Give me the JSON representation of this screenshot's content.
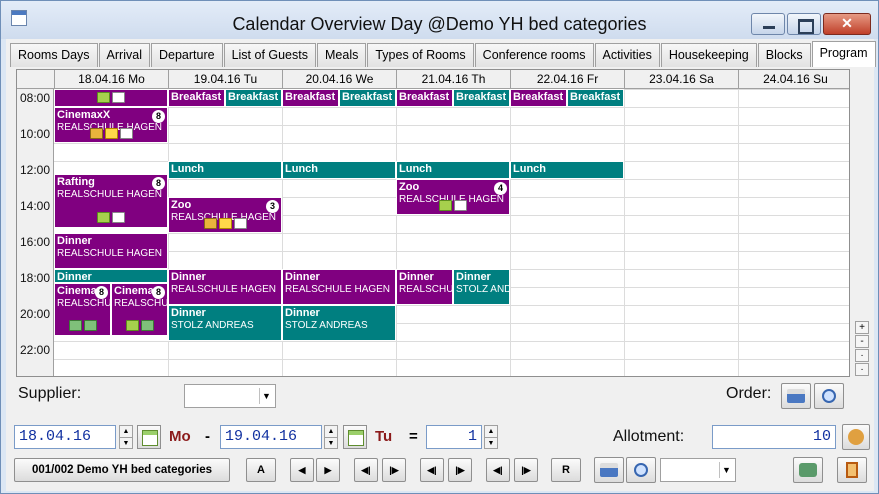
{
  "window": {
    "title": "Calendar Overview Day @Demo YH bed categories"
  },
  "tabs": [
    "Rooms Days",
    "Arrival",
    "Departure",
    "List of Guests",
    "Meals",
    "Types of Rooms",
    "Conference rooms",
    "Activities",
    "Housekeeping",
    "Blocks",
    "Program"
  ],
  "active_tab": "Program",
  "calendar": {
    "days": [
      "18.04.16 Mo",
      "19.04.16 Tu",
      "20.04.16 We",
      "21.04.16 Th",
      "22.04.16 Fr",
      "23.04.16 Sa",
      "24.04.16 Su"
    ],
    "times": [
      "08:00",
      "10:00",
      "12:00",
      "14:00",
      "16:00",
      "18:00",
      "20:00",
      "22:00"
    ],
    "events": [
      {
        "day": 0,
        "start": 8.0,
        "end": 9.0,
        "title": "",
        "sub": "",
        "color": "#800080",
        "icons": [
          "plus",
          "doc"
        ]
      },
      {
        "day": 0,
        "start": 9.0,
        "end": 11.0,
        "title": "CinemaxX",
        "sub": "REALSCHULE HAGEN",
        "count": "8",
        "color": "#800080",
        "icons": [
          "lock",
          "mail",
          "doc"
        ]
      },
      {
        "day": 0,
        "start": 12.7,
        "end": 15.7,
        "title": "Rafting",
        "sub": "REALSCHULE HAGEN",
        "count": "8",
        "color": "#800080",
        "icons": [
          "plus",
          "doc"
        ]
      },
      {
        "day": 0,
        "start": 16.0,
        "end": 18.0,
        "title": "Dinner",
        "sub": "REALSCHULE HAGEN",
        "color": "#800080"
      },
      {
        "day": 0,
        "start": 18.0,
        "end": 18.8,
        "title": "Dinner",
        "sub": "",
        "color": "#007f80"
      },
      {
        "day": 0,
        "start": 18.8,
        "end": 21.7,
        "title": "Cinema",
        "sub": "REALSCHULE",
        "count": "8",
        "color": "#800080",
        "half": 0,
        "icons": [
          "swap",
          "swap"
        ]
      },
      {
        "day": 0,
        "start": 18.8,
        "end": 21.7,
        "title": "Cinema",
        "sub": "REALSCHULE",
        "count": "8",
        "color": "#800080",
        "half": 1,
        "icons": [
          "plus",
          "swap"
        ]
      },
      {
        "day": 1,
        "start": 8.0,
        "end": 9.0,
        "title": "Breakfast",
        "sub": "",
        "color": "#800080",
        "half": 0
      },
      {
        "day": 1,
        "start": 8.0,
        "end": 9.0,
        "title": "Breakfast",
        "sub": "",
        "color": "#007f80",
        "half": 1
      },
      {
        "day": 2,
        "start": 8.0,
        "end": 9.0,
        "title": "Breakfast",
        "sub": "",
        "color": "#800080",
        "half": 0
      },
      {
        "day": 2,
        "start": 8.0,
        "end": 9.0,
        "title": "Breakfast",
        "sub": "",
        "color": "#007f80",
        "half": 1
      },
      {
        "day": 3,
        "start": 8.0,
        "end": 9.0,
        "title": "Breakfast",
        "sub": "",
        "color": "#800080",
        "half": 0
      },
      {
        "day": 3,
        "start": 8.0,
        "end": 9.0,
        "title": "Breakfast",
        "sub": "",
        "color": "#007f80",
        "half": 1
      },
      {
        "day": 4,
        "start": 8.0,
        "end": 9.0,
        "title": "Breakfast",
        "sub": "",
        "color": "#800080",
        "half": 0
      },
      {
        "day": 4,
        "start": 8.0,
        "end": 9.0,
        "title": "Breakfast",
        "sub": "",
        "color": "#007f80",
        "half": 1
      },
      {
        "day": 1,
        "start": 12.0,
        "end": 13.0,
        "title": "Lunch",
        "sub": "",
        "color": "#007f80"
      },
      {
        "day": 2,
        "start": 12.0,
        "end": 13.0,
        "title": "Lunch",
        "sub": "",
        "color": "#007f80"
      },
      {
        "day": 3,
        "start": 12.0,
        "end": 13.0,
        "title": "Lunch",
        "sub": "",
        "color": "#007f80"
      },
      {
        "day": 4,
        "start": 12.0,
        "end": 13.0,
        "title": "Lunch",
        "sub": "",
        "color": "#007f80"
      },
      {
        "day": 1,
        "start": 14.0,
        "end": 16.0,
        "title": "Zoo",
        "sub": "REALSCHULE HAGEN",
        "count": "3",
        "color": "#800080",
        "icons": [
          "lock",
          "mail",
          "doc"
        ]
      },
      {
        "day": 3,
        "start": 13.0,
        "end": 15.0,
        "title": "Zoo",
        "sub": "REALSCHULE HAGEN",
        "count": "4",
        "color": "#800080",
        "icons": [
          "plus",
          "doc"
        ]
      },
      {
        "day": 1,
        "start": 18.0,
        "end": 20.0,
        "title": "Dinner",
        "sub": "REALSCHULE HAGEN",
        "color": "#800080"
      },
      {
        "day": 2,
        "start": 18.0,
        "end": 20.0,
        "title": "Dinner",
        "sub": "REALSCHULE HAGEN",
        "color": "#800080"
      },
      {
        "day": 1,
        "start": 20.0,
        "end": 22.0,
        "title": "Dinner",
        "sub": "STOLZ ANDREAS",
        "color": "#007f80"
      },
      {
        "day": 2,
        "start": 20.0,
        "end": 22.0,
        "title": "Dinner",
        "sub": "STOLZ ANDREAS",
        "color": "#007f80"
      },
      {
        "day": 3,
        "start": 18.0,
        "end": 20.0,
        "title": "Dinner",
        "sub": "REALSCHULE HAGEN",
        "color": "#800080",
        "half": 0
      },
      {
        "day": 3,
        "start": 18.0,
        "end": 20.0,
        "title": "Dinner",
        "sub": "STOLZ ANDREAS",
        "color": "#007f80",
        "half": 1
      }
    ]
  },
  "scroll_buttons": [
    "+",
    "-",
    "·",
    "·"
  ],
  "supplier": {
    "label": "Supplier:",
    "value": ""
  },
  "order": {
    "label": "Order:"
  },
  "range": {
    "from_date": "18.04.16",
    "from_day": "Mo",
    "dash": "-",
    "to_date": "19.04.16",
    "to_day": "Tu",
    "equals": "=",
    "count": "1"
  },
  "allotment": {
    "label": "Allotment:",
    "value": "10"
  },
  "bottom": {
    "category": "001/002 Demo YH bed categories",
    "a_label": "A",
    "r_label": "R",
    "nav": [
      "◀",
      "▶",
      "◀|",
      "|▶",
      "◀|",
      "|▶",
      "◀|",
      "|▶"
    ]
  }
}
